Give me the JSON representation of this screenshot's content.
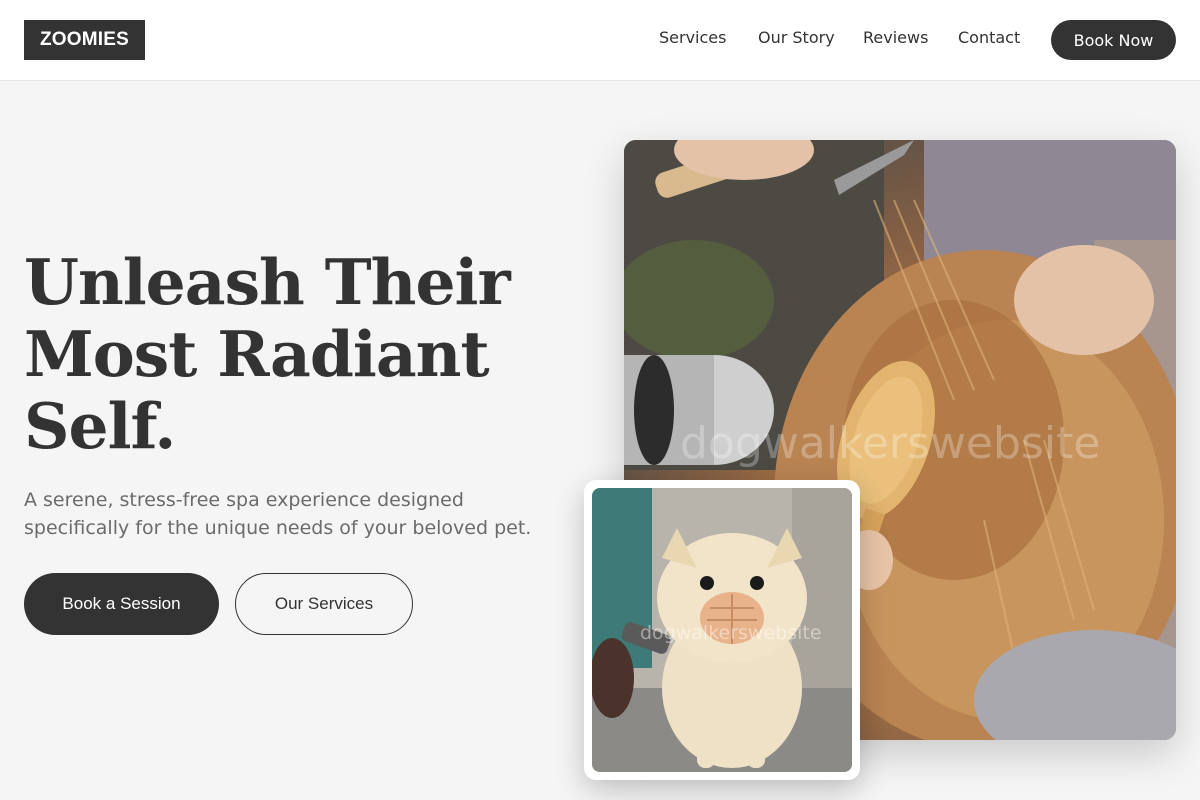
{
  "header": {
    "logo": "ZOOMIES",
    "nav": [
      {
        "label": "Services"
      },
      {
        "label": "Our Story"
      },
      {
        "label": "Reviews"
      },
      {
        "label": "Contact"
      }
    ],
    "cta_label": "Book Now"
  },
  "hero": {
    "title_lines": [
      "Unleash Their",
      "Most Radiant",
      "Self."
    ],
    "subtitle_lines": [
      "A serene, stress-free spa experience designed",
      "specifically for the unique needs of your beloved pet."
    ],
    "primary_button": "Book a Session",
    "secondary_button": "Our Services"
  },
  "images": {
    "main_watermark": "dogwalkerswebsite",
    "small_watermark": "dogwalkerswebsite"
  },
  "colors": {
    "dark": "#333333",
    "background": "#f5f5f5",
    "muted_text": "#6b6b6b"
  }
}
